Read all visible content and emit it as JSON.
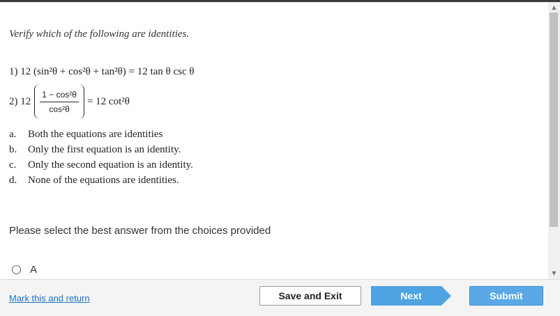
{
  "question": {
    "prompt": "Verify which of the following are identities.",
    "eq1": "1) 12 (sin²θ + cos²θ + tan²θ) = 12 tan θ csc θ",
    "eq2": {
      "prefix": "2) 12",
      "numerator": "1 − cos²θ",
      "denominator": "cos²θ",
      "suffix": "= 12 cot²θ"
    },
    "choices": [
      {
        "letter": "a.",
        "text": "Both the equations are identities"
      },
      {
        "letter": "b.",
        "text": "Only the first equation is an identity."
      },
      {
        "letter": "c.",
        "text": "Only the second equation is an identity."
      },
      {
        "letter": "d.",
        "text": "None of the equations are identities."
      }
    ]
  },
  "instruction": "Please select the best answer from the choices provided",
  "answer_options": [
    {
      "label": "A",
      "selected": false
    }
  ],
  "footer": {
    "mark_link": "Mark this and return",
    "save_label": "Save and Exit",
    "next_label": "Next",
    "submit_label": "Submit"
  },
  "icons": {
    "scroll_up": "chevron-up-icon",
    "scroll_down": "chevron-down-icon"
  },
  "colors": {
    "accent": "#4fa3e3",
    "link": "#1a73c8"
  }
}
